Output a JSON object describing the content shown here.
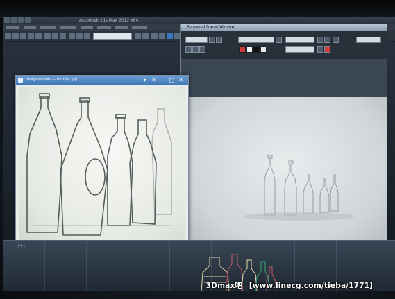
{
  "app": {
    "title": "Autodesk 3ds Max 2012 x64"
  },
  "render_window": {
    "title": "Rendered Frame Window"
  },
  "viewer": {
    "title": "ImageViewer — bottles.jpg"
  },
  "viewport": {
    "label": "[+]"
  },
  "watermark": "3Dmax吧 【www.linecg.com/tieba/1771】",
  "colors": {
    "accent_blue": "#4a82c2",
    "swatch_red": "#d23a3a",
    "swatch_black": "#101214",
    "swatch_white": "#f2f2f2",
    "bottle_red": "#c85a66",
    "bottle_green": "#3fa871",
    "bottle_cream": "#e8d9b0"
  }
}
